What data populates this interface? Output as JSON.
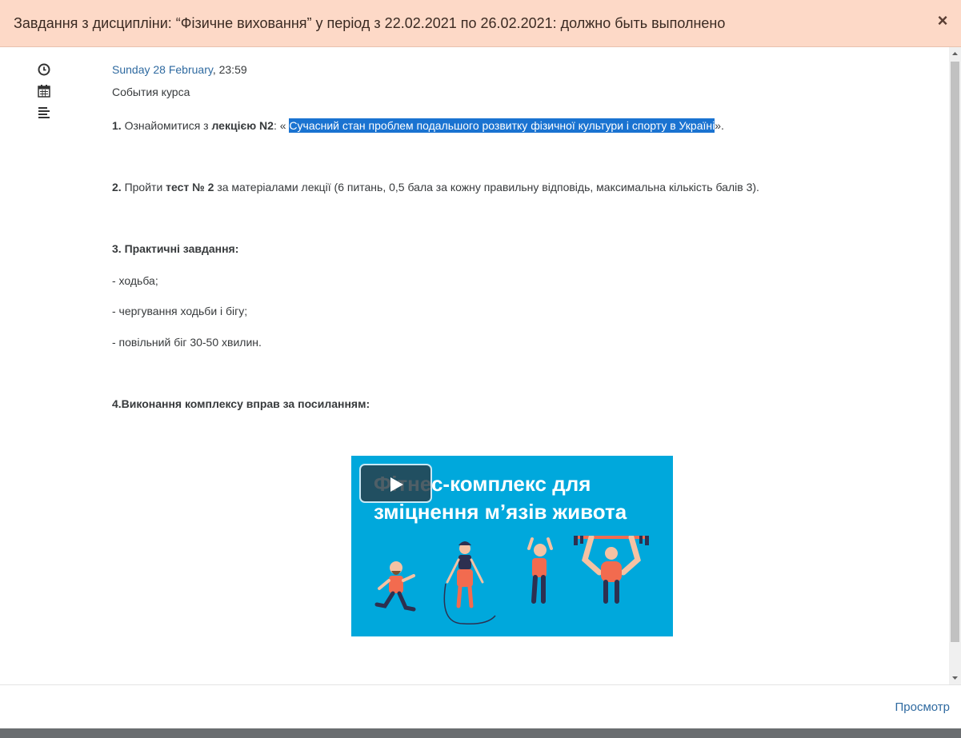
{
  "modal": {
    "title": "Завдання з дисципліни: “Фізичне виховання” у період з 22.02.2021 по 26.02.2021: должно быть выполнено",
    "close_glyph": "×"
  },
  "event": {
    "date_link": "Sunday 28 February",
    "time": ", 23:59",
    "type": "События курса"
  },
  "description": {
    "item1": {
      "num": "1.",
      "text_a": " Ознайомитися з ",
      "bold": "лекцією N2",
      "text_b": ": « ",
      "link": "Сучасний стан проблем подальшого розвитку фізичної культури і спорту в Україні",
      "text_c": "»."
    },
    "item2": {
      "num": "2.",
      "text_a": " Пройти ",
      "bold": "тест № 2",
      "text_b": " за матеріалами лекції (6 питань, 0,5 бала за кожну правильну відповідь, максимальна кількість балів 3)."
    },
    "item3": {
      "heading": "3. Практичні завдання:",
      "lines": [
        "- ходьба;",
        "- чергування ходьби і бігу;",
        "- повільний біг 30-50 хвилин."
      ]
    },
    "item4": {
      "heading": "4.Виконання комплексу вправ за посиланням:"
    }
  },
  "video": {
    "title_line1": "Фітнес-комплекс для",
    "title_line2": "зміцнення м’язів живота"
  },
  "footer": {
    "preview_link": "Просмотр"
  },
  "colors": {
    "header_bg": "#fdd9c7",
    "link": "#2f6aa0",
    "video_bg": "#00a8dc",
    "figure_orange": "#f26b4f",
    "figure_navy": "#2d3050"
  },
  "icons": [
    "clock-icon",
    "calendar-icon",
    "align-left-icon",
    "play-icon",
    "close-icon"
  ]
}
